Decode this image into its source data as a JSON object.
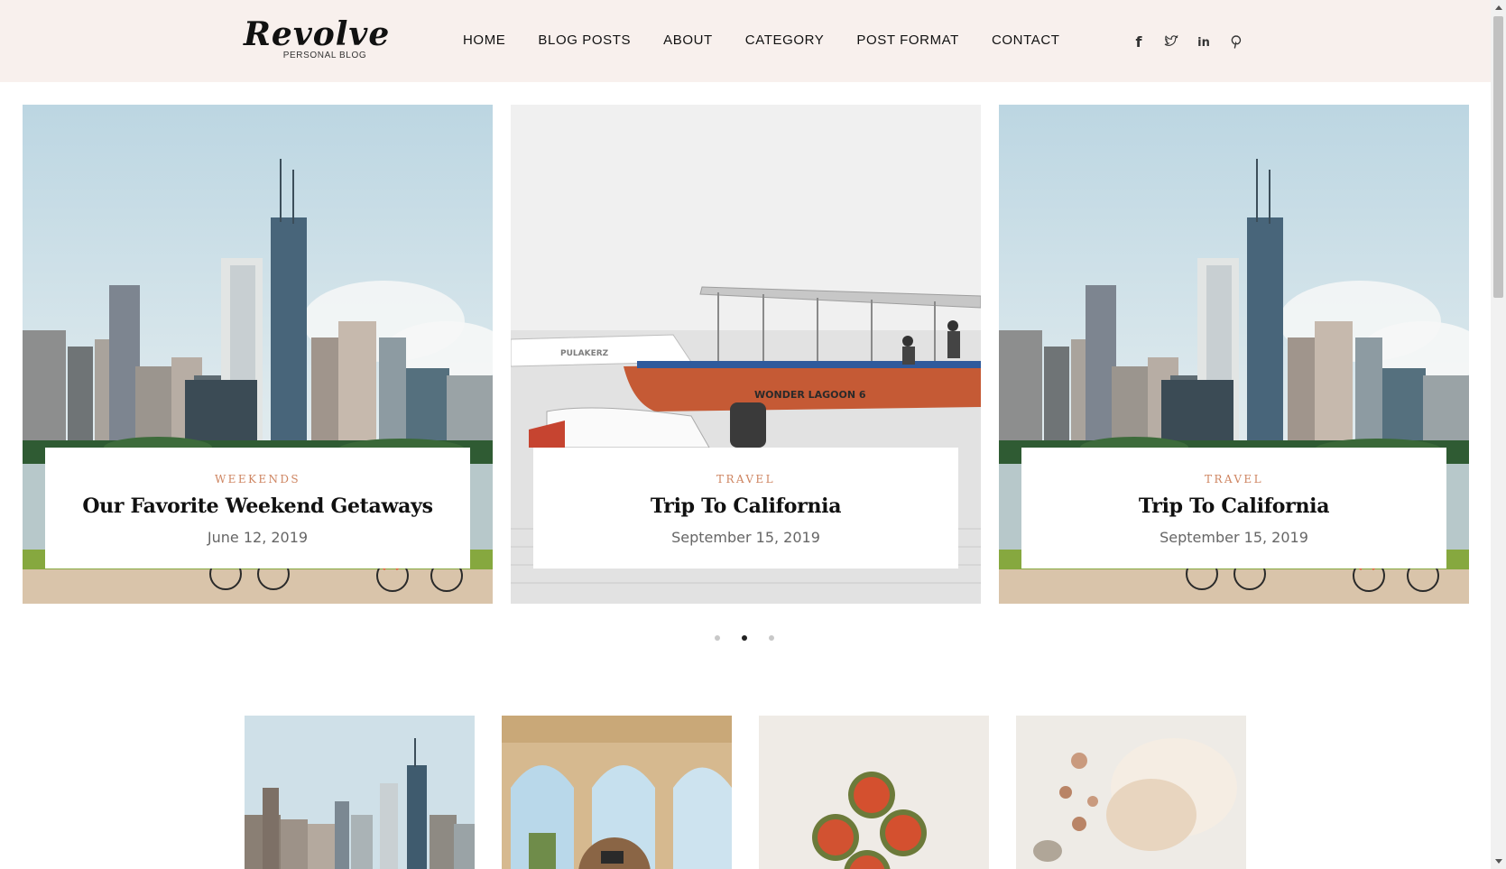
{
  "brand": {
    "title": "Revolve",
    "subtitle": "PERSONAL BLOG"
  },
  "nav": {
    "items": [
      {
        "label": "HOME"
      },
      {
        "label": "BLOG POSTS"
      },
      {
        "label": "ABOUT"
      },
      {
        "label": "CATEGORY"
      },
      {
        "label": "POST FORMAT"
      },
      {
        "label": "CONTACT"
      }
    ]
  },
  "social": {
    "icons": [
      "facebook-icon",
      "twitter-icon",
      "linkedin-icon",
      "pinterest-icon"
    ],
    "labels": {
      "facebook": "f",
      "linkedin": "in"
    }
  },
  "slider": {
    "slides": [
      {
        "category": "WEEKENDS",
        "title": "Our Favorite Weekend Getaways",
        "date": "June 12, 2019",
        "image": "city-skyline"
      },
      {
        "category": "TRAVEL",
        "title": "Trip To California",
        "date": "September 15, 2019",
        "image": "boat-lagoon"
      },
      {
        "category": "TRAVEL",
        "title": "Trip To California",
        "date": "September 15, 2019",
        "image": "city-skyline"
      }
    ],
    "boat_labels": {
      "main": "WONDER LAGOON 6",
      "side": "PULAKERZ"
    },
    "dots": {
      "count": 3,
      "active_index": 1
    }
  },
  "thumbnails": [
    {
      "image": "city-skyline"
    },
    {
      "image": "stone-arches"
    },
    {
      "image": "figs"
    },
    {
      "image": "cotton-beads"
    }
  ],
  "colors": {
    "header_bg": "#f8f0ed",
    "category_accent": "#ce8460",
    "text_dark": "#111111",
    "date_gray": "#666666"
  }
}
